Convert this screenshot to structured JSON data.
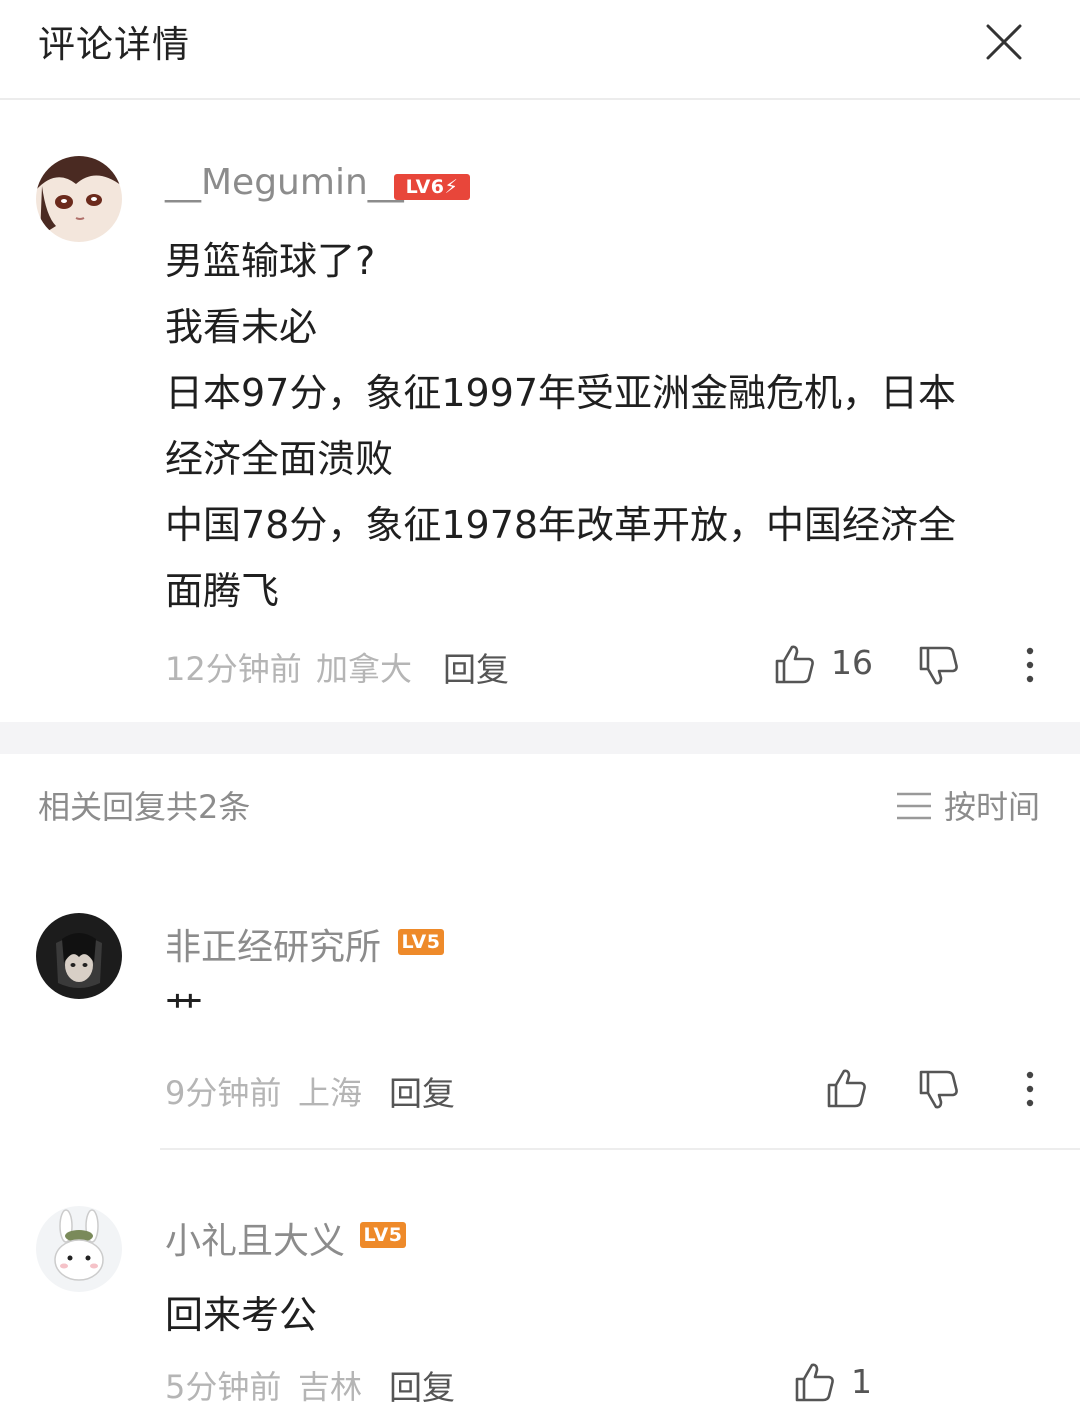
{
  "header": {
    "title": "评论详情",
    "close_icon": "close-icon"
  },
  "main_comment": {
    "username": "__Megumin__",
    "level_badge": "LV6⚡",
    "lines": [
      "男篮输球了?",
      "我看未必",
      "日本97分，象征1997年受亚洲金融危机，日本",
      "经济全面溃败",
      "中国78分，象征1978年改革开放，中国经济全",
      "面腾飞"
    ],
    "time": "12分钟前",
    "location": "加拿大",
    "reply_label": "回复",
    "like_count": "16"
  },
  "replies_header": {
    "label": "相关回复共2条",
    "sort_label": "按时间"
  },
  "replies": [
    {
      "username": "非正经研究所",
      "level_badge": "LV5",
      "text": "艹",
      "time": "9分钟前",
      "location": "上海",
      "reply_label": "回复",
      "like_count": ""
    },
    {
      "username": "小礼且大义",
      "level_badge": "LV5",
      "text": "回来考公",
      "time": "5分钟前",
      "location": "吉林",
      "reply_label": "回复",
      "like_count": "1"
    }
  ],
  "colors": {
    "lv6": "#e8463a",
    "lv5": "#ee8a2a",
    "meta_text": "#b5b5b5",
    "name_text": "#8c8c8c"
  }
}
